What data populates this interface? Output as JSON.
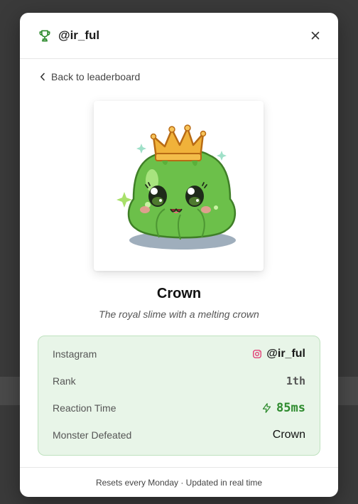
{
  "header": {
    "title": "@ir_ful",
    "trophy_icon": "trophy-icon",
    "close_icon": "close-icon"
  },
  "nav": {
    "back_label": "Back to leaderboard"
  },
  "monster": {
    "name": "Crown",
    "description": "The royal slime with a melting crown"
  },
  "stats": {
    "instagram_label": "Instagram",
    "instagram_value": "@ir_ful",
    "rank_label": "Rank",
    "rank_value": "1th",
    "reaction_label": "Reaction Time",
    "reaction_value": "85ms",
    "defeated_label": "Monster Defeated",
    "defeated_value": "Crown"
  },
  "footer": {
    "text": "Resets every Monday · Updated in real time"
  },
  "colors": {
    "accent_green": "#2e8b2e",
    "stats_bg": "#e8f5e8",
    "instagram_pink": "#e1306c"
  }
}
